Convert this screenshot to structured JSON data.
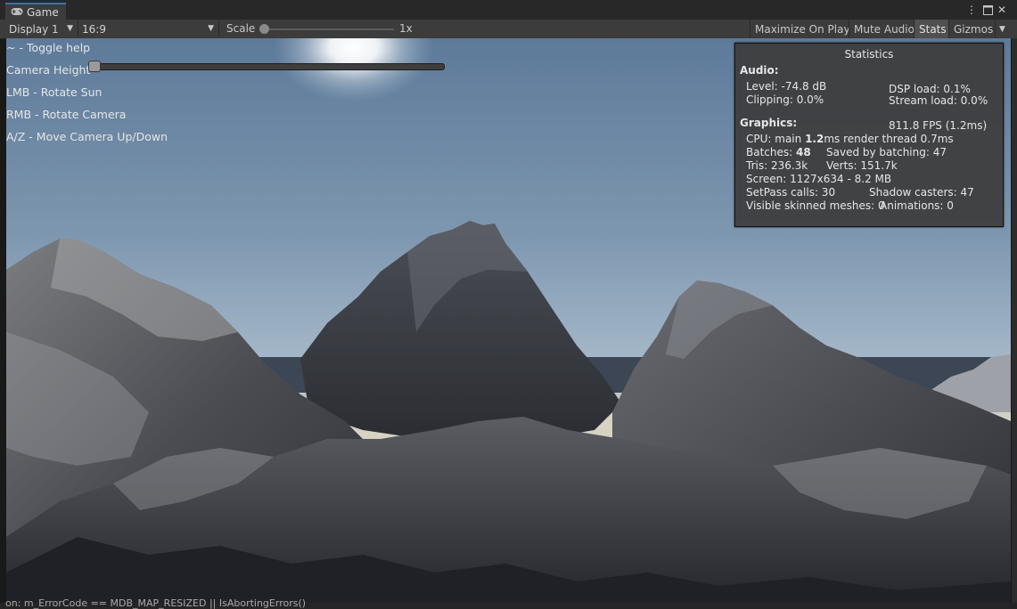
{
  "tab": {
    "label": "Game",
    "icon": "gamepad-icon"
  },
  "window_controls": {
    "menu_icon": "kebab-menu-icon",
    "maximize_icon": "maximize-icon",
    "close_icon": "close-icon"
  },
  "toolbar": {
    "display": "Display 1",
    "aspect": "16:9",
    "scale_label": "Scale",
    "scale_value": "1x",
    "scale_slider_fraction": 0.0,
    "maximize_on_play": "Maximize On Play",
    "mute_audio": "Mute Audio",
    "stats": "Stats",
    "gizmos": "Gizmos"
  },
  "help": {
    "toggle": "~ - Toggle help",
    "camera_height": "Camera Height",
    "camera_height_fraction": 0.0,
    "lmb": "LMB - Rotate Sun",
    "rmb": "RMB - Rotate Camera",
    "az": "A/Z - Move Camera Up/Down"
  },
  "stats": {
    "title": "Statistics",
    "audio_header": "Audio:",
    "level": "Level: -74.8 dB",
    "clipping": "Clipping: 0.0%",
    "dsp_load": "DSP load: 0.1%",
    "stream_load": "Stream load: 0.0%",
    "graphics_header": "Graphics:",
    "fps": "811.8 FPS (1.2ms)",
    "cpu_prefix": "CPU: main ",
    "cpu_main": "1.2",
    "cpu_suffix": "ms  render thread 0.7ms",
    "batches_prefix": "Batches: ",
    "batches": "48",
    "saved_batching": "Saved by batching: 47",
    "tris": "Tris: 236.3k",
    "verts": "Verts: 151.7k",
    "screen": "Screen: 1127x634 - 8.2 MB",
    "setpass": "SetPass calls: 30",
    "shadow_casters": "Shadow casters: 47",
    "skinned": "Visible skinned meshes: 0",
    "animations": "Animations: 0"
  },
  "console_line": "on: m_ErrorCode == MDB_MAP_RESIZED || IsAbortingErrors()"
}
